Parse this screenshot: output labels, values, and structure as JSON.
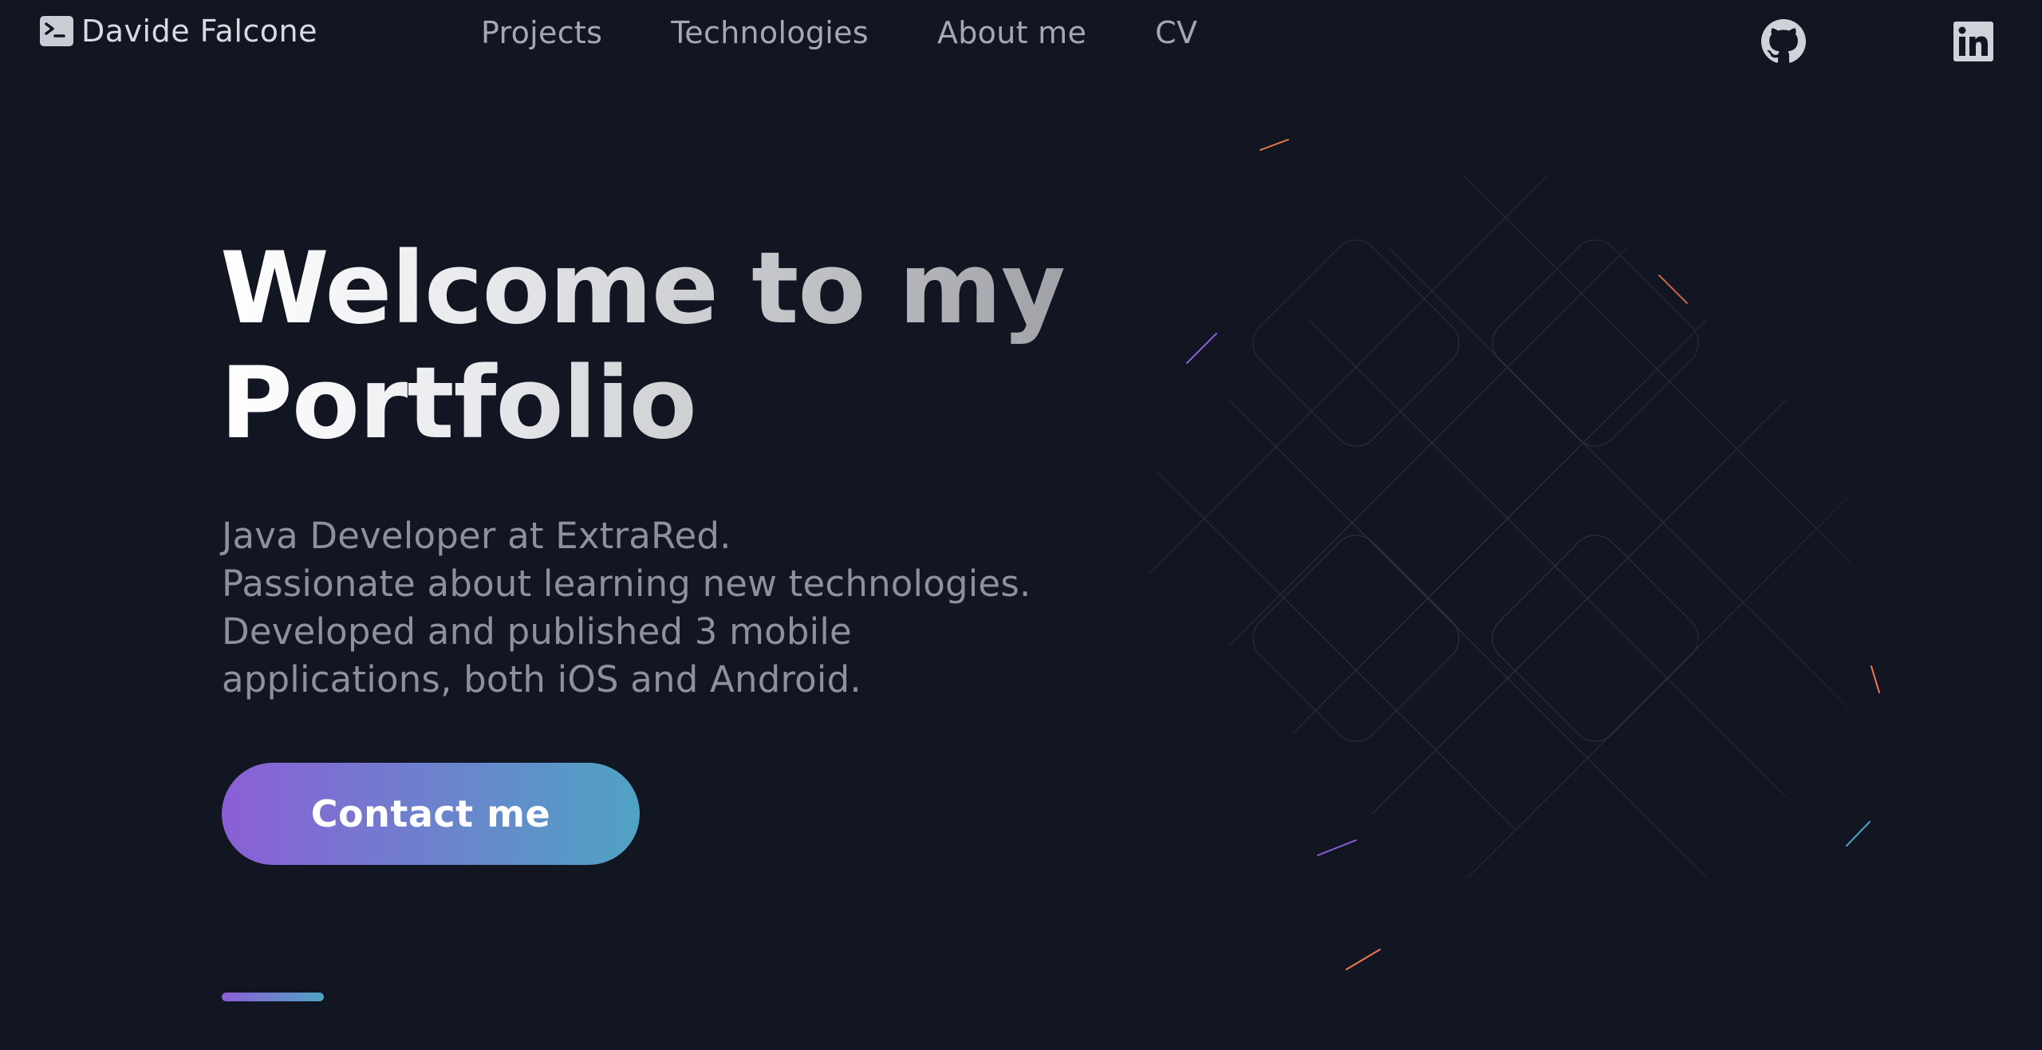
{
  "header": {
    "brand_name": "Davide Falcone",
    "brand_icon": "terminal-icon",
    "nav": [
      {
        "label": "Projects"
      },
      {
        "label": "Technologies"
      },
      {
        "label": "About me"
      },
      {
        "label": "CV"
      }
    ],
    "social": [
      {
        "icon": "github-icon"
      },
      {
        "icon": "linkedin-icon"
      }
    ]
  },
  "hero": {
    "title_line1": "Welcome to my",
    "title_line2": "Portfolio",
    "subtitle_lines": [
      "Java Developer at ExtraRed.",
      "Passionate about learning new technologies.",
      "Developed and published 3 mobile",
      "applications, both iOS and Android."
    ],
    "cta_label": "Contact me"
  },
  "colors": {
    "background": "#111622",
    "gradient_start": "#8b5fd6",
    "gradient_end": "#4fa3c4",
    "nav_text": "#a4a8b2",
    "subtitle_text": "#8d919b"
  }
}
